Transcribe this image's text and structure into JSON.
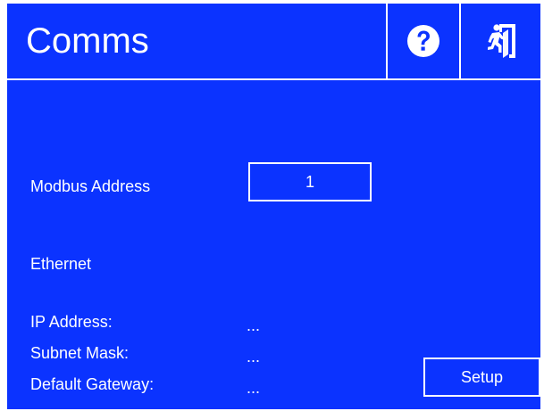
{
  "colors": {
    "background": "#0b33ff",
    "foreground": "#ffffff"
  },
  "header": {
    "title": "Comms",
    "help_icon": "question-circle-icon",
    "exit_icon": "exit-running-person-icon"
  },
  "modbus": {
    "label": "Modbus Address",
    "value": "1"
  },
  "ethernet": {
    "heading": "Ethernet",
    "fields": [
      {
        "label": "IP Address:",
        "value": "..."
      },
      {
        "label": "Subnet Mask:",
        "value": "..."
      },
      {
        "label": "Default Gateway:",
        "value": "..."
      }
    ],
    "setup_label": "Setup"
  }
}
